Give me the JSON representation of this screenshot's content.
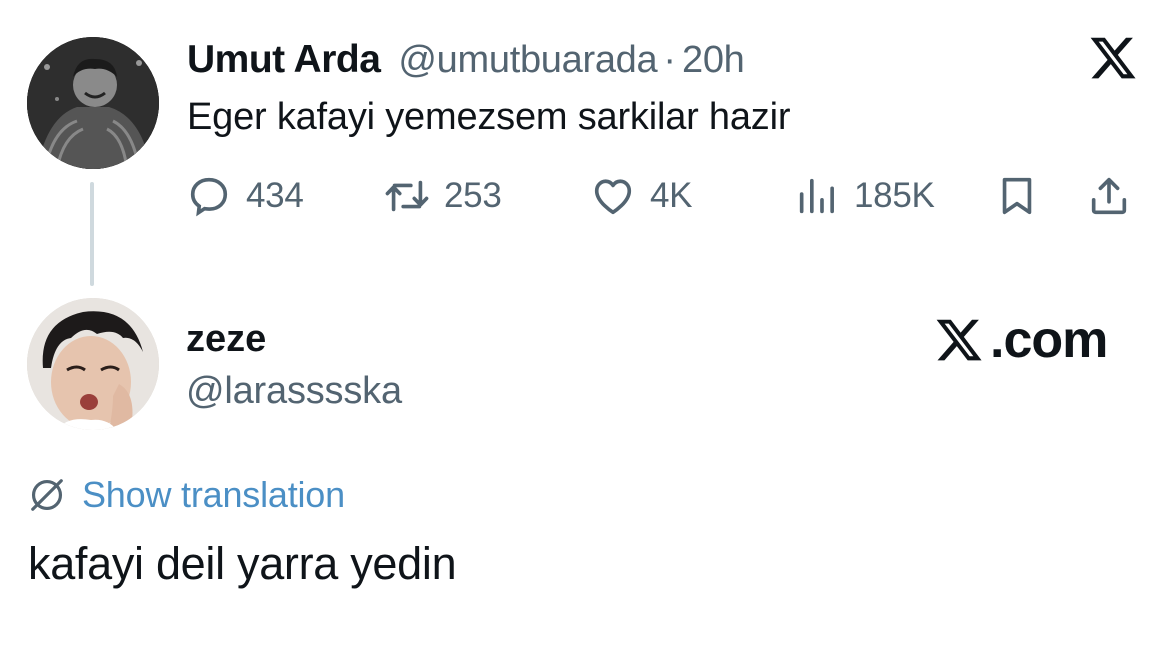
{
  "tweet1": {
    "author_name": "Umut Arda",
    "handle": "@umutbuarada",
    "separator": "·",
    "time": "20h",
    "text": "Eger kafayi yemezsem sarkilar hazir",
    "actions": {
      "reply": {
        "icon": "reply-icon",
        "count": "434"
      },
      "retweet": {
        "icon": "retweet-icon",
        "count": "253"
      },
      "like": {
        "icon": "heart-icon",
        "count": "4K"
      },
      "views": {
        "icon": "views-icon",
        "count": "185K"
      },
      "bookmark": {
        "icon": "bookmark-icon"
      },
      "share": {
        "icon": "share-icon"
      }
    }
  },
  "tweet2": {
    "author_name": "zeze",
    "handle": "@larasssska",
    "translation_label": "Show translation",
    "text": "kafayi deil yarra yedin"
  },
  "branding": {
    "logo_icon": "x-logo-icon",
    "site_suffix": ".com"
  },
  "colors": {
    "text_primary": "#0f1419",
    "text_secondary": "#536471",
    "link": "#4b8fc5",
    "thread_line": "#cfd9de"
  }
}
